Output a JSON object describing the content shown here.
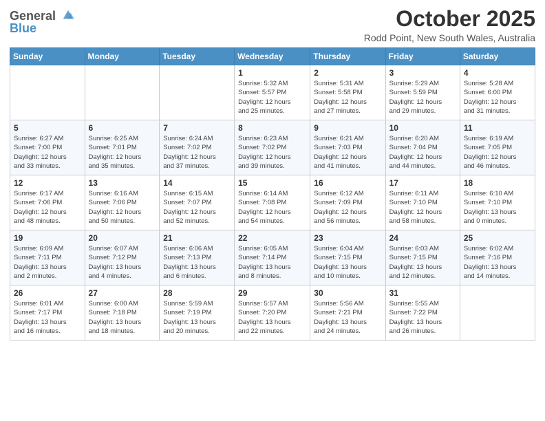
{
  "logo": {
    "line1": "General",
    "line2": "Blue"
  },
  "title": "October 2025",
  "location": "Rodd Point, New South Wales, Australia",
  "days_header": [
    "Sunday",
    "Monday",
    "Tuesday",
    "Wednesday",
    "Thursday",
    "Friday",
    "Saturday"
  ],
  "weeks": [
    [
      {
        "day": "",
        "info": ""
      },
      {
        "day": "",
        "info": ""
      },
      {
        "day": "",
        "info": ""
      },
      {
        "day": "1",
        "info": "Sunrise: 5:32 AM\nSunset: 5:57 PM\nDaylight: 12 hours\nand 25 minutes."
      },
      {
        "day": "2",
        "info": "Sunrise: 5:31 AM\nSunset: 5:58 PM\nDaylight: 12 hours\nand 27 minutes."
      },
      {
        "day": "3",
        "info": "Sunrise: 5:29 AM\nSunset: 5:59 PM\nDaylight: 12 hours\nand 29 minutes."
      },
      {
        "day": "4",
        "info": "Sunrise: 5:28 AM\nSunset: 6:00 PM\nDaylight: 12 hours\nand 31 minutes."
      }
    ],
    [
      {
        "day": "5",
        "info": "Sunrise: 6:27 AM\nSunset: 7:00 PM\nDaylight: 12 hours\nand 33 minutes."
      },
      {
        "day": "6",
        "info": "Sunrise: 6:25 AM\nSunset: 7:01 PM\nDaylight: 12 hours\nand 35 minutes."
      },
      {
        "day": "7",
        "info": "Sunrise: 6:24 AM\nSunset: 7:02 PM\nDaylight: 12 hours\nand 37 minutes."
      },
      {
        "day": "8",
        "info": "Sunrise: 6:23 AM\nSunset: 7:02 PM\nDaylight: 12 hours\nand 39 minutes."
      },
      {
        "day": "9",
        "info": "Sunrise: 6:21 AM\nSunset: 7:03 PM\nDaylight: 12 hours\nand 41 minutes."
      },
      {
        "day": "10",
        "info": "Sunrise: 6:20 AM\nSunset: 7:04 PM\nDaylight: 12 hours\nand 44 minutes."
      },
      {
        "day": "11",
        "info": "Sunrise: 6:19 AM\nSunset: 7:05 PM\nDaylight: 12 hours\nand 46 minutes."
      }
    ],
    [
      {
        "day": "12",
        "info": "Sunrise: 6:17 AM\nSunset: 7:06 PM\nDaylight: 12 hours\nand 48 minutes."
      },
      {
        "day": "13",
        "info": "Sunrise: 6:16 AM\nSunset: 7:06 PM\nDaylight: 12 hours\nand 50 minutes."
      },
      {
        "day": "14",
        "info": "Sunrise: 6:15 AM\nSunset: 7:07 PM\nDaylight: 12 hours\nand 52 minutes."
      },
      {
        "day": "15",
        "info": "Sunrise: 6:14 AM\nSunset: 7:08 PM\nDaylight: 12 hours\nand 54 minutes."
      },
      {
        "day": "16",
        "info": "Sunrise: 6:12 AM\nSunset: 7:09 PM\nDaylight: 12 hours\nand 56 minutes."
      },
      {
        "day": "17",
        "info": "Sunrise: 6:11 AM\nSunset: 7:10 PM\nDaylight: 12 hours\nand 58 minutes."
      },
      {
        "day": "18",
        "info": "Sunrise: 6:10 AM\nSunset: 7:10 PM\nDaylight: 13 hours\nand 0 minutes."
      }
    ],
    [
      {
        "day": "19",
        "info": "Sunrise: 6:09 AM\nSunset: 7:11 PM\nDaylight: 13 hours\nand 2 minutes."
      },
      {
        "day": "20",
        "info": "Sunrise: 6:07 AM\nSunset: 7:12 PM\nDaylight: 13 hours\nand 4 minutes."
      },
      {
        "day": "21",
        "info": "Sunrise: 6:06 AM\nSunset: 7:13 PM\nDaylight: 13 hours\nand 6 minutes."
      },
      {
        "day": "22",
        "info": "Sunrise: 6:05 AM\nSunset: 7:14 PM\nDaylight: 13 hours\nand 8 minutes."
      },
      {
        "day": "23",
        "info": "Sunrise: 6:04 AM\nSunset: 7:15 PM\nDaylight: 13 hours\nand 10 minutes."
      },
      {
        "day": "24",
        "info": "Sunrise: 6:03 AM\nSunset: 7:15 PM\nDaylight: 13 hours\nand 12 minutes."
      },
      {
        "day": "25",
        "info": "Sunrise: 6:02 AM\nSunset: 7:16 PM\nDaylight: 13 hours\nand 14 minutes."
      }
    ],
    [
      {
        "day": "26",
        "info": "Sunrise: 6:01 AM\nSunset: 7:17 PM\nDaylight: 13 hours\nand 16 minutes."
      },
      {
        "day": "27",
        "info": "Sunrise: 6:00 AM\nSunset: 7:18 PM\nDaylight: 13 hours\nand 18 minutes."
      },
      {
        "day": "28",
        "info": "Sunrise: 5:59 AM\nSunset: 7:19 PM\nDaylight: 13 hours\nand 20 minutes."
      },
      {
        "day": "29",
        "info": "Sunrise: 5:57 AM\nSunset: 7:20 PM\nDaylight: 13 hours\nand 22 minutes."
      },
      {
        "day": "30",
        "info": "Sunrise: 5:56 AM\nSunset: 7:21 PM\nDaylight: 13 hours\nand 24 minutes."
      },
      {
        "day": "31",
        "info": "Sunrise: 5:55 AM\nSunset: 7:22 PM\nDaylight: 13 hours\nand 26 minutes."
      },
      {
        "day": "",
        "info": ""
      }
    ]
  ]
}
